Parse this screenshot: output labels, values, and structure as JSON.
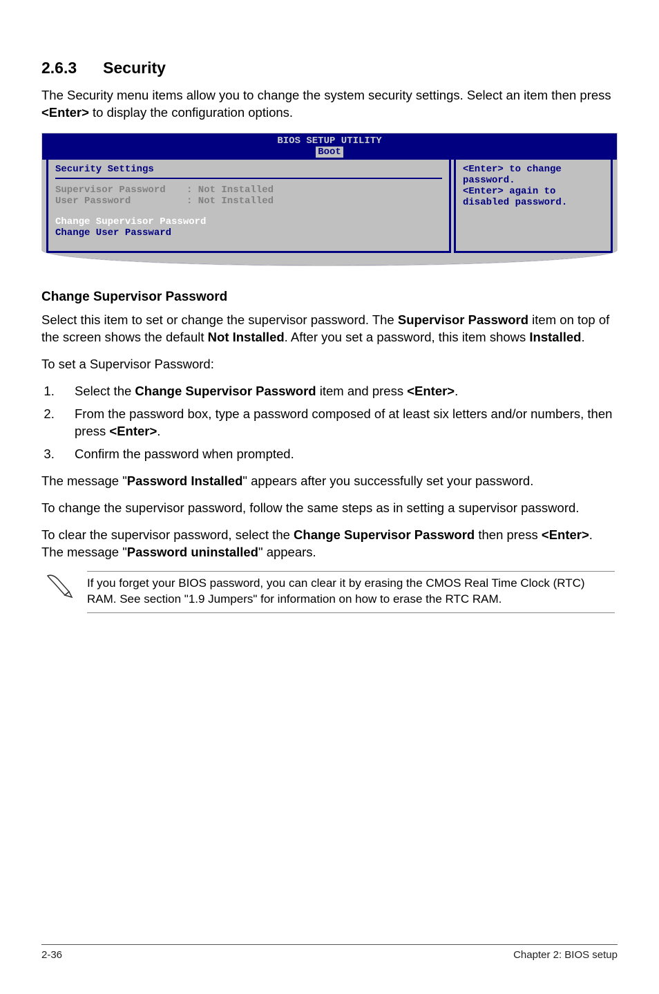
{
  "heading": {
    "number": "2.6.3",
    "title": "Security"
  },
  "intro": {
    "part1": "The Security menu items allow you to change the system security settings. Select an item then press ",
    "enter": "<Enter>",
    "part2": " to display the configuration options."
  },
  "bios": {
    "title": "BIOS SETUP UTILITY",
    "tab": "Boot",
    "section_title": "Security Settings",
    "sup_label": "Supervisor Password",
    "sup_value": ": Not Installed",
    "user_label": "User Password",
    "user_value": ": Not Installed",
    "change_sup": "Change Supervisor Password",
    "change_user": "Change User Passward",
    "help1": "<Enter> to change password.",
    "help2": "<Enter> again to disabled password."
  },
  "sub_heading": "Change Supervisor Password",
  "para1": {
    "a": "Select this item to set or change the supervisor password. The ",
    "b": "Supervisor Password",
    "c": " item on top of the screen shows the default ",
    "d": "Not Installed",
    "e": ". After you set a password, this item shows ",
    "f": "Installed",
    "g": "."
  },
  "para2": "To set a Supervisor Password:",
  "list": {
    "i1a": "Select the ",
    "i1b": "Change Supervisor Password",
    "i1c": " item and press ",
    "i1d": "<Enter>",
    "i1e": ".",
    "i2a": "From the password box, type a password composed of at least six letters and/or numbers, then press ",
    "i2b": "<Enter>",
    "i2c": ".",
    "i3": "Confirm the password when prompted."
  },
  "para3": {
    "a": "The message \"",
    "b": "Password Installed",
    "c": "\" appears after you successfully set your password."
  },
  "para4": "To change the supervisor password, follow the same steps as in setting a supervisor password.",
  "para5": {
    "a": "To clear the supervisor password, select the ",
    "b": "Change Supervisor Password",
    "c": " then press ",
    "d": "<Enter>",
    "e": ". The message \"",
    "f": "Password uninstalled",
    "g": "\" appears."
  },
  "note": "If you forget your BIOS password, you can clear it by erasing the CMOS Real Time Clock (RTC) RAM. See section \"1.9 Jumpers\" for information on how to erase the RTC RAM.",
  "footer": {
    "left": "2-36",
    "right": "Chapter 2: BIOS setup"
  }
}
